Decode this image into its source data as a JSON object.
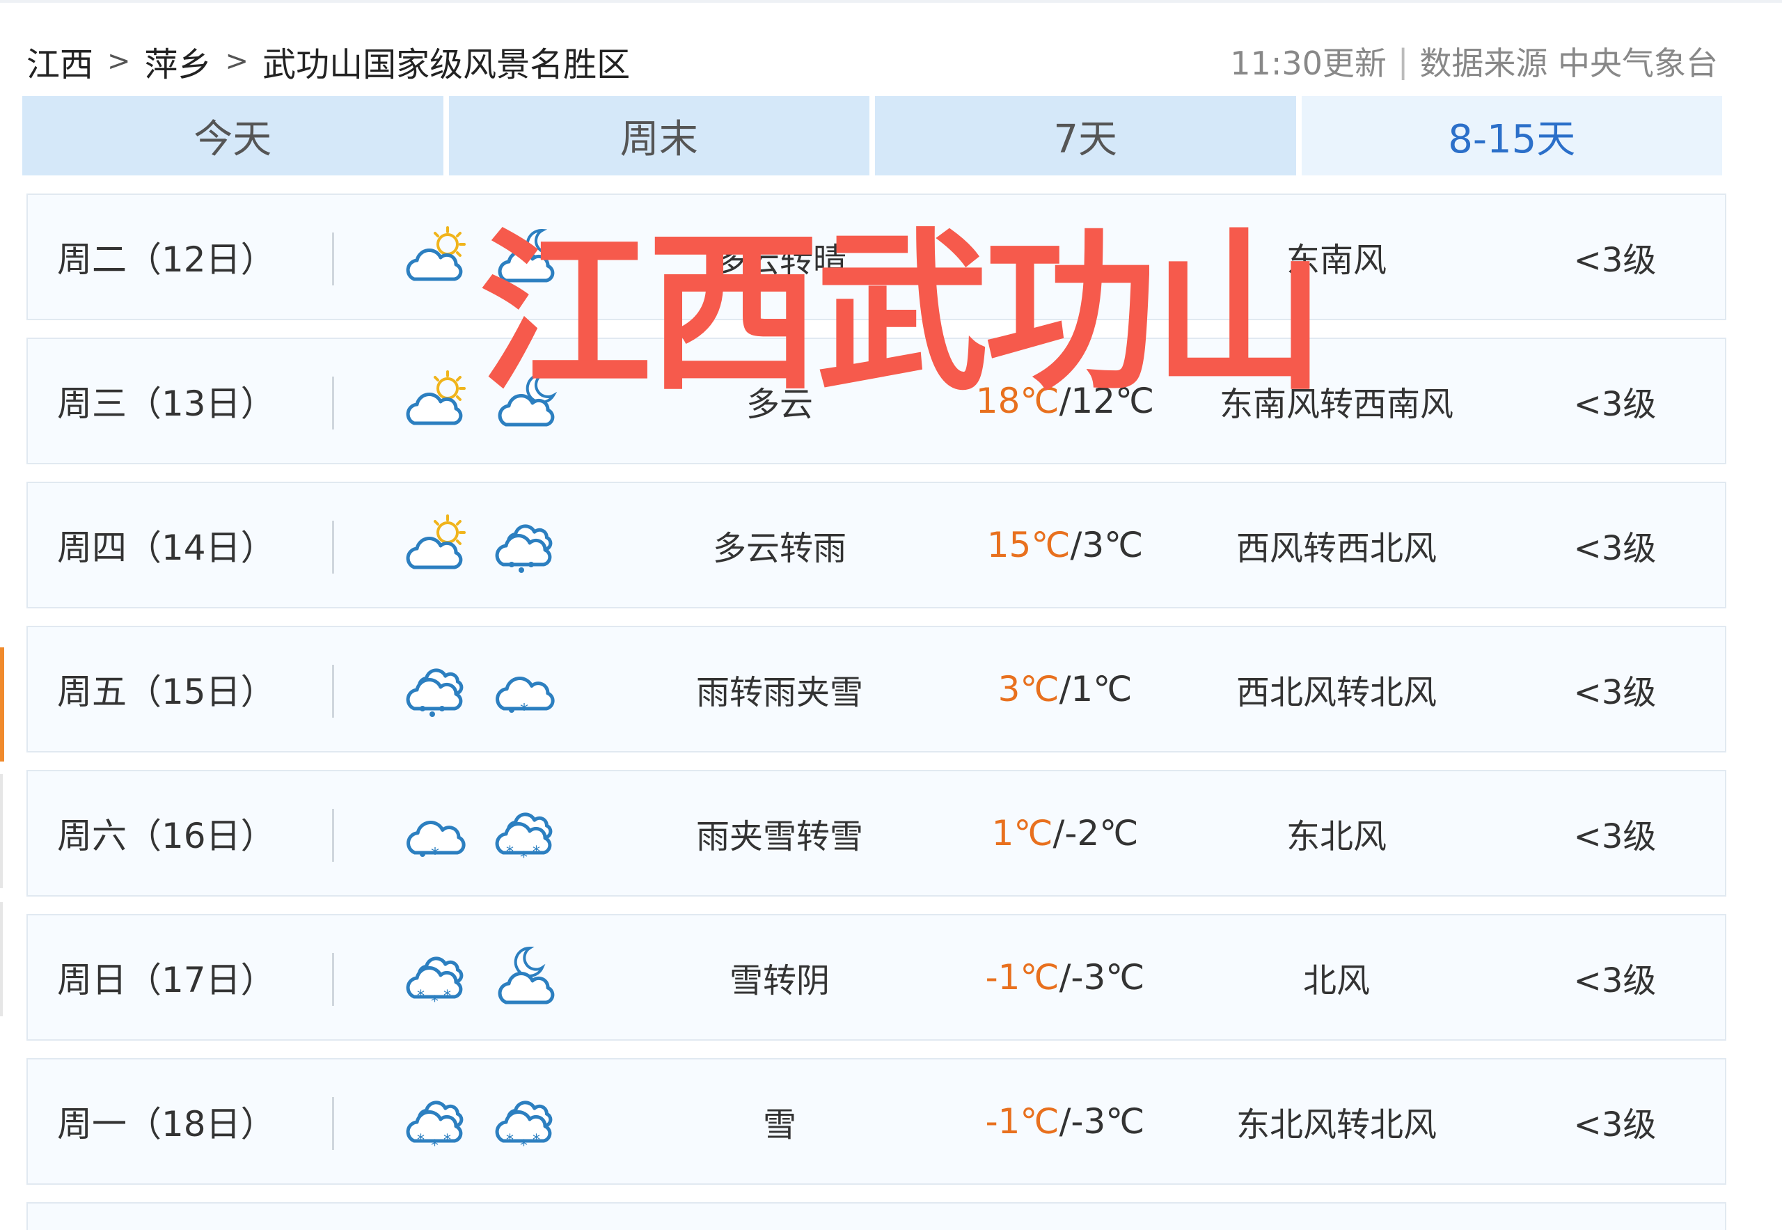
{
  "breadcrumb": {
    "province": "江西",
    "city": "萍乡",
    "area": "武功山国家级风景名胜区",
    "separator": ">"
  },
  "update": {
    "time": "11:30更新",
    "divider": "|",
    "source": "数据来源 中央气象台"
  },
  "tabs": [
    {
      "label": "今天",
      "active": false
    },
    {
      "label": "周末",
      "active": false
    },
    {
      "label": "7天",
      "active": false
    },
    {
      "label": "8-15天",
      "active": true
    }
  ],
  "rows": [
    {
      "date": "周二（12日）",
      "icon1": "partly-cloudy-day-icon",
      "icon2": "partly-cloudy-night-icon",
      "desc": "多云转晴",
      "high": "",
      "low": "",
      "wind": "东南风",
      "level": "<3级"
    },
    {
      "date": "周三（13日）",
      "icon1": "partly-cloudy-day-icon",
      "icon2": "partly-cloudy-night-icon",
      "desc": "多云",
      "high": "18℃",
      "low": "/12℃",
      "wind": "东南风转西南风",
      "level": "<3级"
    },
    {
      "date": "周四（14日）",
      "icon1": "partly-cloudy-day-icon",
      "icon2": "rain-icon",
      "desc": "多云转雨",
      "high": "15℃",
      "low": "/3℃",
      "wind": "西风转西北风",
      "level": "<3级"
    },
    {
      "date": "周五（15日）",
      "icon1": "rain-icon",
      "icon2": "sleet-icon",
      "desc": "雨转雨夹雪",
      "high": "3℃",
      "low": "/1℃",
      "wind": "西北风转北风",
      "level": "<3级"
    },
    {
      "date": "周六（16日）",
      "icon1": "sleet-icon",
      "icon2": "snow-icon",
      "desc": "雨夹雪转雪",
      "high": "1℃",
      "low": "/-2℃",
      "wind": "东北风",
      "level": "<3级"
    },
    {
      "date": "周日（17日）",
      "icon1": "snow-icon",
      "icon2": "cloudy-night-icon",
      "desc": "雪转阴",
      "high": "-1℃",
      "low": "/-3℃",
      "wind": "北风",
      "level": "<3级"
    },
    {
      "date": "周一（18日）",
      "icon1": "snow-icon",
      "icon2": "snow-icon",
      "desc": "雪",
      "high": "-1℃",
      "low": "/-3℃",
      "wind": "东北风转北风",
      "level": "<3级"
    }
  ],
  "overlay": {
    "title": "江西武功山",
    "color": "#f65a4c"
  },
  "colors": {
    "tab_bg": "#d5e8f9",
    "tab_active_text": "#2b6fc9",
    "temp_high": "#e8701e",
    "icon_blue": "#2c7fc0",
    "icon_sun": "#f0b41c",
    "side_accent": "#f08a2c"
  }
}
